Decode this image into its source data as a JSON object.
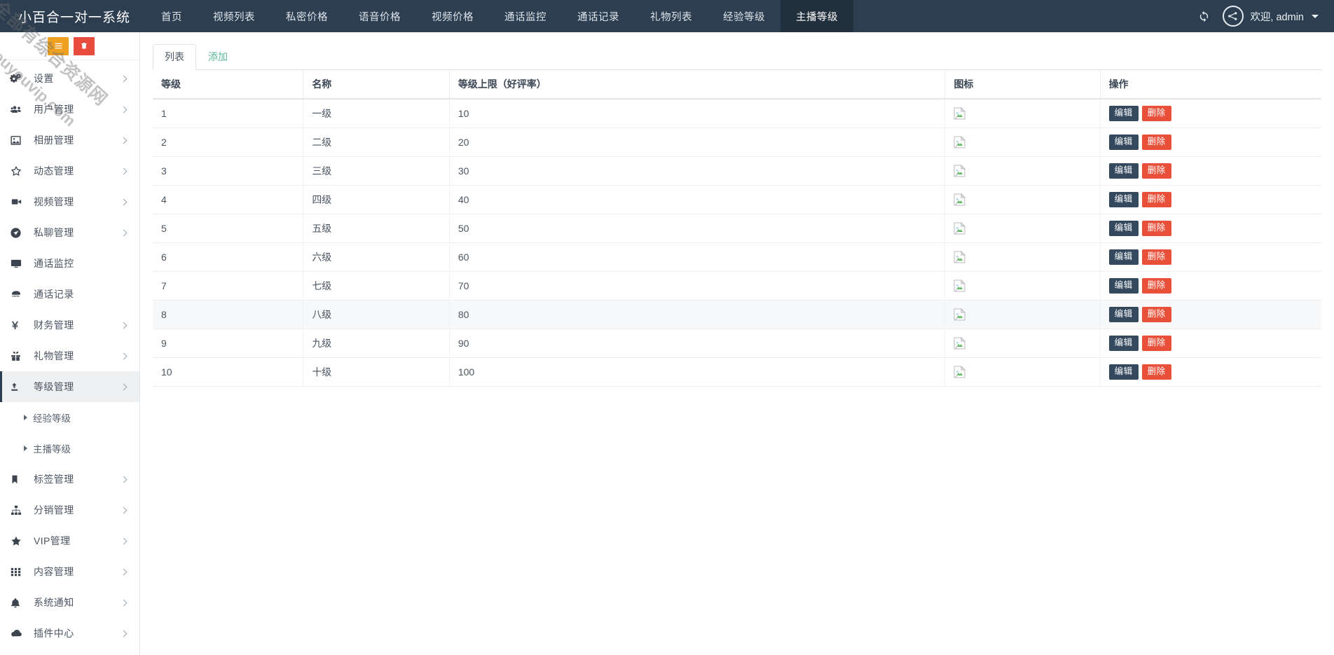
{
  "navbar": {
    "brand": "小百合一对一系统",
    "items": [
      {
        "label": "首页",
        "active": false
      },
      {
        "label": "视频列表",
        "active": false
      },
      {
        "label": "私密价格",
        "active": false
      },
      {
        "label": "语音价格",
        "active": false
      },
      {
        "label": "视频价格",
        "active": false
      },
      {
        "label": "通话监控",
        "active": false
      },
      {
        "label": "通话记录",
        "active": false
      },
      {
        "label": "礼物列表",
        "active": false
      },
      {
        "label": "经验等级",
        "active": false
      },
      {
        "label": "主播等级",
        "active": true
      }
    ],
    "refresh_icon": "refresh-icon",
    "avatar_icon": "user-avatar-network-icon",
    "user_label": "欢迎, admin",
    "caret_icon": "caret-down-icon",
    "bg_color": "#2c3e50",
    "active_bg_color": "#22303e"
  },
  "sidebar": {
    "tools": [
      {
        "name": "collapse-button",
        "icon": "bars-icon",
        "color": "#f0a020"
      },
      {
        "name": "trash-button",
        "icon": "trash-icon",
        "color": "#e74c3c"
      }
    ],
    "items": [
      {
        "label": "设置",
        "icon": "gears-icon",
        "chevron": true,
        "active": false
      },
      {
        "label": "用户管理",
        "icon": "users-icon",
        "chevron": true,
        "active": false
      },
      {
        "label": "相册管理",
        "icon": "image-icon",
        "chevron": true,
        "active": false
      },
      {
        "label": "动态管理",
        "icon": "star-icon",
        "chevron": true,
        "active": false
      },
      {
        "label": "视频管理",
        "icon": "video-icon",
        "chevron": true,
        "active": false
      },
      {
        "label": "私聊管理",
        "icon": "send-icon",
        "chevron": true,
        "active": false
      },
      {
        "label": "通话监控",
        "icon": "monitor-icon",
        "chevron": false,
        "active": false
      },
      {
        "label": "通话记录",
        "icon": "phone-icon",
        "chevron": false,
        "active": false
      },
      {
        "label": "财务管理",
        "icon": "yen-icon",
        "chevron": true,
        "active": false
      },
      {
        "label": "礼物管理",
        "icon": "gift-icon",
        "chevron": true,
        "active": false
      },
      {
        "label": "等级管理",
        "icon": "level-up-icon",
        "chevron": true,
        "active": true
      }
    ],
    "submenu": [
      {
        "label": "经验等级"
      },
      {
        "label": "主播等级"
      }
    ],
    "items_after": [
      {
        "label": "标签管理",
        "icon": "bookmark-icon",
        "chevron": true,
        "active": false
      },
      {
        "label": "分销管理",
        "icon": "sitemap-icon",
        "chevron": true,
        "active": false
      },
      {
        "label": "VIP管理",
        "icon": "star-solid-icon",
        "chevron": true,
        "active": false
      },
      {
        "label": "内容管理",
        "icon": "grid-icon",
        "chevron": true,
        "active": false
      },
      {
        "label": "系统通知",
        "icon": "bell-icon",
        "chevron": true,
        "active": false
      },
      {
        "label": "插件中心",
        "icon": "cloud-icon",
        "chevron": true,
        "active": false
      }
    ]
  },
  "watermark": {
    "line1": "全部有综合资源网",
    "line2": "douyouvip.com"
  },
  "main": {
    "tabs": [
      {
        "label": "列表",
        "active": true
      },
      {
        "label": "添加",
        "active": false
      }
    ],
    "table": {
      "headers": [
        "等级",
        "名称",
        "等级上限（好评率）",
        "图标",
        "操作"
      ],
      "icon_cell": "broken-image-icon",
      "actions": {
        "edit": "编辑",
        "delete": "删除"
      },
      "rows": [
        {
          "level": "1",
          "name": "一级",
          "limit": "10",
          "hover": false
        },
        {
          "level": "2",
          "name": "二级",
          "limit": "20",
          "hover": false
        },
        {
          "level": "3",
          "name": "三级",
          "limit": "30",
          "hover": false
        },
        {
          "level": "4",
          "name": "四级",
          "limit": "40",
          "hover": false
        },
        {
          "level": "5",
          "name": "五级",
          "limit": "50",
          "hover": false
        },
        {
          "level": "6",
          "name": "六级",
          "limit": "60",
          "hover": false
        },
        {
          "level": "7",
          "name": "七级",
          "limit": "70",
          "hover": false
        },
        {
          "level": "8",
          "name": "八级",
          "limit": "80",
          "hover": true
        },
        {
          "level": "9",
          "name": "九级",
          "limit": "90",
          "hover": false
        },
        {
          "level": "10",
          "name": "十级",
          "limit": "100",
          "hover": false
        }
      ]
    }
  },
  "colors": {
    "navbar": "#2c3e50",
    "tab_link": "#5cb79b",
    "btn_edit": "#34495e",
    "btn_delete": "#e8503a",
    "tool_orange": "#f0a020",
    "tool_red": "#e74c3c"
  }
}
